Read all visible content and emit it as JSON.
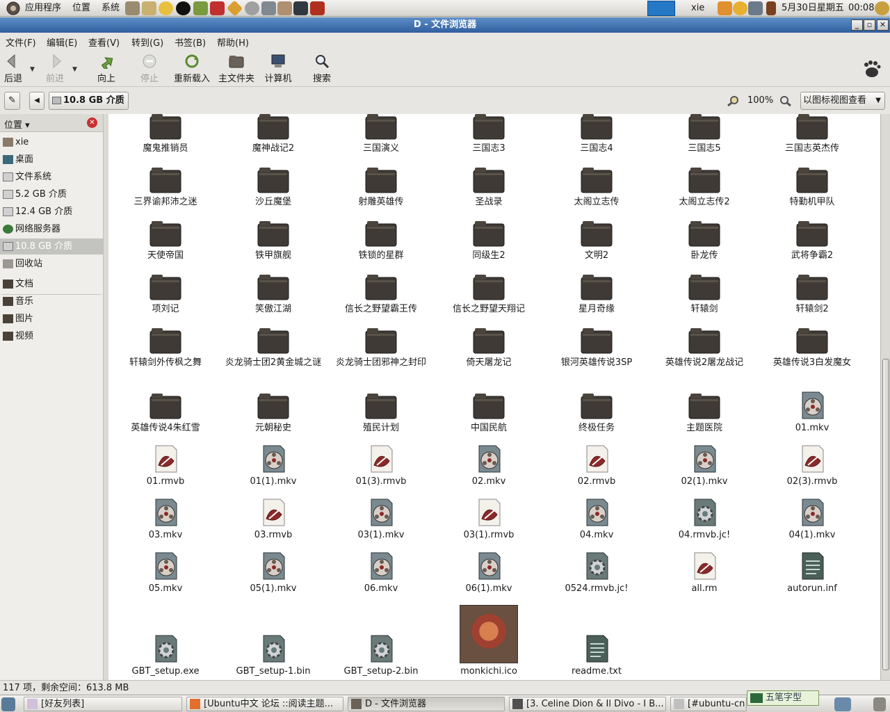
{
  "top_panel": {
    "applications": "应用程序",
    "places": "位置",
    "system": "系统",
    "user": "xie",
    "date": "5月30日星期五",
    "time": "00:08"
  },
  "window": {
    "title": "D - 文件浏览器"
  },
  "menubar": [
    "文件(F)",
    "编辑(E)",
    "查看(V)",
    "转到(G)",
    "书签(B)",
    "帮助(H)"
  ],
  "toolbar": {
    "back": "后退",
    "forward": "前进",
    "up": "向上",
    "stop": "停止",
    "reload": "重新载入",
    "home": "主文件夹",
    "computer": "计算机",
    "search": "搜索"
  },
  "location": {
    "current": "10.8 GB 介质",
    "zoom": "100%",
    "view_mode": "以图标视图查看"
  },
  "sidebar": {
    "header": "位置",
    "items": [
      {
        "label": "xie",
        "icon": "home-icon"
      },
      {
        "label": "桌面",
        "icon": "desktop-icon"
      },
      {
        "label": "文件系统",
        "icon": "drive-icon"
      },
      {
        "label": "5.2 GB 介质",
        "icon": "drive-icon"
      },
      {
        "label": "12.4 GB 介质",
        "icon": "drive-icon"
      },
      {
        "label": "网络服务器",
        "icon": "network-icon"
      },
      {
        "label": "10.8 GB 介质",
        "icon": "drive-icon"
      },
      {
        "label": "回收站",
        "icon": "trash-icon"
      },
      {
        "label": "文档",
        "icon": "folder-icon"
      },
      {
        "label": "音乐",
        "icon": "folder-icon"
      },
      {
        "label": "图片",
        "icon": "folder-icon"
      },
      {
        "label": "视频",
        "icon": "folder-icon"
      }
    ]
  },
  "files": [
    {
      "name": "魔鬼推销员",
      "type": "folder"
    },
    {
      "name": "魔神战记2",
      "type": "folder"
    },
    {
      "name": "三国演义",
      "type": "folder"
    },
    {
      "name": "三国志3",
      "type": "folder"
    },
    {
      "name": "三国志4",
      "type": "folder"
    },
    {
      "name": "三国志5",
      "type": "folder"
    },
    {
      "name": "三国志英杰传",
      "type": "folder"
    },
    {
      "name": "三界谕邦沛之迷",
      "type": "folder"
    },
    {
      "name": "沙丘魔堡",
      "type": "folder"
    },
    {
      "name": "射雕英雄传",
      "type": "folder"
    },
    {
      "name": "圣战录",
      "type": "folder"
    },
    {
      "name": "太阁立志传",
      "type": "folder"
    },
    {
      "name": "太阁立志传2",
      "type": "folder"
    },
    {
      "name": "特勤机甲队",
      "type": "folder"
    },
    {
      "name": "天使帝国",
      "type": "folder"
    },
    {
      "name": "铁甲旗舰",
      "type": "folder"
    },
    {
      "name": "铁锁的星群",
      "type": "folder"
    },
    {
      "name": "同级生2",
      "type": "folder"
    },
    {
      "name": "文明2",
      "type": "folder"
    },
    {
      "name": "卧龙传",
      "type": "folder"
    },
    {
      "name": "武将争霸2",
      "type": "folder"
    },
    {
      "name": "项刘记",
      "type": "folder"
    },
    {
      "name": "笑傲江湖",
      "type": "folder"
    },
    {
      "name": "信长之野望霸王传",
      "type": "folder"
    },
    {
      "name": "信长之野望天翔记",
      "type": "folder"
    },
    {
      "name": "星月奇缘",
      "type": "folder"
    },
    {
      "name": "轩辕剑",
      "type": "folder"
    },
    {
      "name": "轩辕剑2",
      "type": "folder"
    },
    {
      "name": "轩辕剑外传枫之舞",
      "type": "folder"
    },
    {
      "name": "炎龙骑士团2黄金城之谜",
      "type": "folder"
    },
    {
      "name": "炎龙骑士团邪神之封印",
      "type": "folder"
    },
    {
      "name": "倚天屠龙记",
      "type": "folder"
    },
    {
      "name": "银河英雄传说3SP",
      "type": "folder"
    },
    {
      "name": "英雄传说2屠龙战记",
      "type": "folder"
    },
    {
      "name": "英雄传说3白发魔女",
      "type": "folder"
    },
    {
      "name": "英雄传说4朱红雪",
      "type": "folder"
    },
    {
      "name": "元朝秘史",
      "type": "folder"
    },
    {
      "name": "殖民计划",
      "type": "folder"
    },
    {
      "name": "中国民航",
      "type": "folder"
    },
    {
      "name": "终极任务",
      "type": "folder"
    },
    {
      "name": "主题医院",
      "type": "folder"
    },
    {
      "name": "01.mkv",
      "type": "video"
    },
    {
      "name": "01.rmvb",
      "type": "rmvb"
    },
    {
      "name": "01(1).mkv",
      "type": "video"
    },
    {
      "name": "01(3).rmvb",
      "type": "rmvb"
    },
    {
      "name": "02.mkv",
      "type": "video"
    },
    {
      "name": "02.rmvb",
      "type": "rmvb"
    },
    {
      "name": "02(1).mkv",
      "type": "video"
    },
    {
      "name": "02(3).rmvb",
      "type": "rmvb"
    },
    {
      "name": "03.mkv",
      "type": "video"
    },
    {
      "name": "03.rmvb",
      "type": "rmvb"
    },
    {
      "name": "03(1).mkv",
      "type": "video"
    },
    {
      "name": "03(1).rmvb",
      "type": "rmvb"
    },
    {
      "name": "04.mkv",
      "type": "video"
    },
    {
      "name": "04.rmvb.jc!",
      "type": "exec"
    },
    {
      "name": "04(1).mkv",
      "type": "video"
    },
    {
      "name": "05.mkv",
      "type": "video"
    },
    {
      "name": "05(1).mkv",
      "type": "video"
    },
    {
      "name": "06.mkv",
      "type": "video"
    },
    {
      "name": "06(1).mkv",
      "type": "video"
    },
    {
      "name": "0524.rmvb.jc!",
      "type": "exec"
    },
    {
      "name": "all.rm",
      "type": "rmvb"
    },
    {
      "name": "autorun.inf",
      "type": "text"
    },
    {
      "name": "GBT_setup.exe",
      "type": "exec"
    },
    {
      "name": "GBT_setup-1.bin",
      "type": "exec"
    },
    {
      "name": "GBT_setup-2.bin",
      "type": "exec"
    },
    {
      "name": "monkichi.ico",
      "type": "image"
    },
    {
      "name": "readme.txt",
      "type": "text"
    }
  ],
  "status": "117 项，剩余空间：613.8 MB",
  "taskbar": [
    {
      "label": "[好友列表]",
      "icon": "qq-icon"
    },
    {
      "label": "[Ubuntu中文 论坛 ::阅读主题...",
      "icon": "firefox-icon"
    },
    {
      "label": "D - 文件浏览器",
      "icon": "folder-icon"
    },
    {
      "label": "[3. Celine Dion & Il Divo - I B...",
      "icon": "music-icon"
    },
    {
      "label": "[#ubuntu-cn]",
      "icon": "chat-icon"
    }
  ],
  "ime": "五笔字型",
  "colors": {
    "title_bar": "#3f6faf",
    "selection": "#c3c3c0",
    "folder": "#3f3a35"
  }
}
